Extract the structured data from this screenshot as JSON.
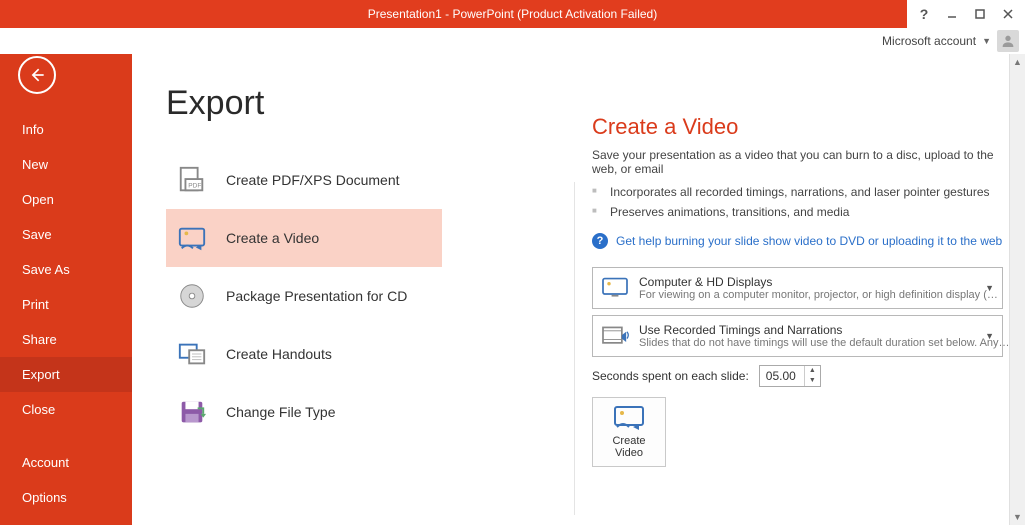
{
  "titlebar": {
    "title": "Presentation1 -  PowerPoint (Product Activation Failed)"
  },
  "account": {
    "label": "Microsoft account"
  },
  "sidebar": {
    "items": [
      "Info",
      "New",
      "Open",
      "Save",
      "Save As",
      "Print",
      "Share",
      "Export",
      "Close",
      "Account",
      "Options"
    ],
    "selected_index": 7
  },
  "page": {
    "title": "Export"
  },
  "export_options": {
    "items": [
      "Create PDF/XPS Document",
      "Create a Video",
      "Package Presentation for CD",
      "Create Handouts",
      "Change File Type"
    ],
    "selected_index": 1
  },
  "video": {
    "heading": "Create a Video",
    "description": "Save your presentation as a video that you can burn to a disc, upload to the web, or email",
    "bullets": [
      "Incorporates all recorded timings, narrations, and laser pointer gestures",
      "Preserves animations, transitions, and media"
    ],
    "help_link": "Get help burning your slide show video to DVD or uploading it to the web",
    "combo1": {
      "title": "Computer & HD Displays",
      "subtitle": "For viewing on a computer monitor, projector, or high definition display  (…"
    },
    "combo2": {
      "title": "Use Recorded Timings and Narrations",
      "subtitle": "Slides that do not have timings will use the default duration set below. Any…"
    },
    "seconds_label": "Seconds spent on each slide:",
    "seconds_value": "05.00",
    "create_button_line1": "Create",
    "create_button_line2": "Video"
  }
}
